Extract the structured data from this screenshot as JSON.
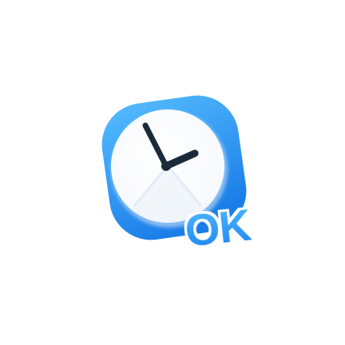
{
  "app_icon": {
    "icon": "clock-icon",
    "badge_text": "OK",
    "colors": {
      "tile_top": "#4fb7ff",
      "tile_bottom": "#1c7fe8",
      "face": "#ffffff",
      "face_shade": "#eef3fb",
      "hands": "#1b2a3a"
    }
  }
}
